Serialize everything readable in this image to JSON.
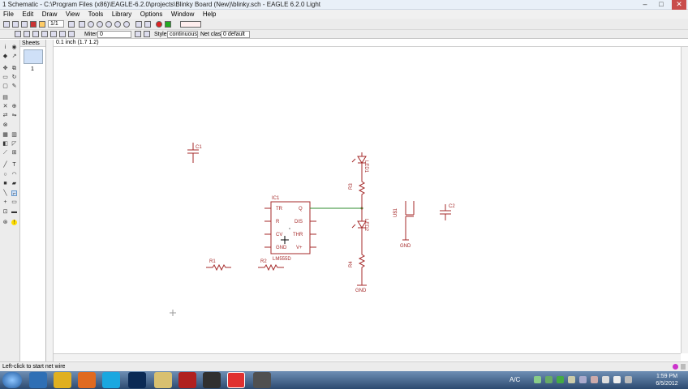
{
  "window": {
    "title": "1 Schematic - C:\\Program Files (x86)\\EAGLE-6.2.0\\projects\\Blinky Board (New)\\blinky.sch - EAGLE 6.2.0 Light",
    "minimize": "–",
    "maximize": "□",
    "close": "✕"
  },
  "menu": [
    "File",
    "Edit",
    "Draw",
    "View",
    "Tools",
    "Library",
    "Options",
    "Window",
    "Help"
  ],
  "toolbar": {
    "sheet_select": "1/1",
    "miter_label": "Miter:",
    "miter_value": "0",
    "style_label": "Style:",
    "style_value": "continuous",
    "netclass_label": "Net class:",
    "netclass_value": "0 default"
  },
  "sheets": {
    "header": "Sheets",
    "numbers": [
      "1"
    ]
  },
  "coordinate_readout": "0.1 inch (1.7 1.2)",
  "schematic": {
    "c1": "C1",
    "ic1": "IC1",
    "ic1_value": "LM555D",
    "ic1_pins_left": [
      "TR",
      "R",
      "CV",
      "GND"
    ],
    "ic1_pins_right": [
      "Q",
      "DIS",
      "THR",
      "V+"
    ],
    "r1": "R1",
    "r2": "R2",
    "led1": "LED1",
    "led2": "LED2",
    "r3": "R3",
    "r4": "R4",
    "u1": "U$1",
    "c2": "C2",
    "gnd1": "GND",
    "gnd2": "GND"
  },
  "status_text": "Left-click to start net wire",
  "clock": {
    "time": "1:59 PM",
    "date": "6/5/2012"
  },
  "tray_label": "A/C",
  "colors": {
    "part": "#a52a2a",
    "net": "#2e8b2e",
    "taskbar": "#3a5a80"
  }
}
